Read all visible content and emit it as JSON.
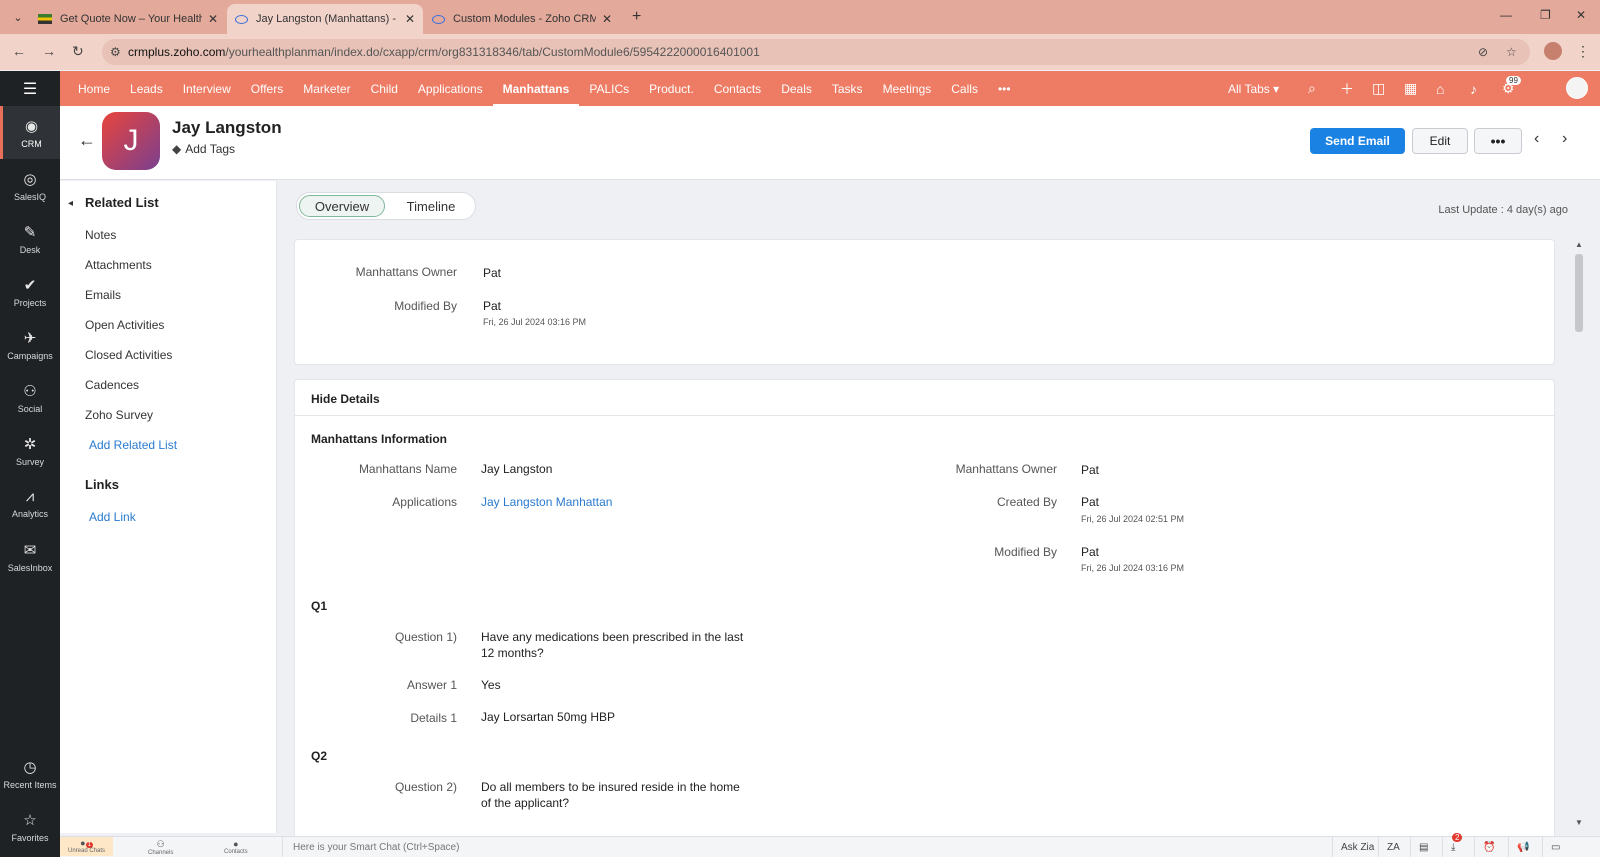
{
  "browser": {
    "tabs": [
      {
        "title": "Get Quote Now – Your Health Pl",
        "favicon": "flag-icon"
      },
      {
        "title": "Jay Langston (Manhattans) - Zoho",
        "favicon": "crm-eye-icon"
      },
      {
        "title": "Custom Modules - Zoho CRM",
        "favicon": "crm-eye-icon"
      }
    ],
    "url_host": "crmplus.zoho.com",
    "url_path": "/yourhealthplanman/index.do/cxapp/crm/org831318346/tab/CustomModule6/5954222000016401001"
  },
  "app_sidebar": {
    "items": [
      {
        "label": "CRM",
        "icon": "◉"
      },
      {
        "label": "SalesIQ",
        "icon": "◎"
      },
      {
        "label": "Desk",
        "icon": "✎"
      },
      {
        "label": "Projects",
        "icon": "✔"
      },
      {
        "label": "Campaigns",
        "icon": "✈"
      },
      {
        "label": "Social",
        "icon": "⚇"
      },
      {
        "label": "Survey",
        "icon": "✲"
      },
      {
        "label": "Analytics",
        "icon": "⩘"
      },
      {
        "label": "SalesInbox",
        "icon": "✉"
      }
    ],
    "bottom": [
      {
        "label": "Recent Items",
        "icon": "◷"
      },
      {
        "label": "Favorites",
        "icon": "☆"
      }
    ]
  },
  "module_nav": {
    "tabs": [
      "Home",
      "Leads",
      "Interview",
      "Offers",
      "Marketer",
      "Child",
      "Applications",
      "Manhattans",
      "PALICs",
      "Product.",
      "Contacts",
      "Deals",
      "Tasks",
      "Meetings",
      "Calls",
      "•••"
    ],
    "active": "Manhattans",
    "all_tabs": "All Tabs ▾",
    "notif_count": "99"
  },
  "record": {
    "initial": "J",
    "name": "Jay Langston",
    "add_tags": "Add Tags",
    "send_email": "Send Email",
    "edit": "Edit",
    "more": "•••"
  },
  "related": {
    "heading": "Related List",
    "items": [
      "Notes",
      "Attachments",
      "Emails",
      "Open Activities",
      "Closed Activities",
      "Cadences",
      "Zoho Survey"
    ],
    "add_related": "Add Related List",
    "links_heading": "Links",
    "add_link": "Add Link"
  },
  "view": {
    "tabs": [
      "Overview",
      "Timeline"
    ],
    "last_update": "Last Update : 4 day(s) ago"
  },
  "summary": {
    "owner_label": "Manhattans Owner",
    "owner_value": "Pat",
    "modified_label": "Modified By",
    "modified_value": "Pat",
    "modified_time": "Fri, 26 Jul 2024 03:16 PM"
  },
  "details": {
    "hide_details": "Hide Details",
    "section_title": "Manhattans Information",
    "name_label": "Manhattans Name",
    "name_value": "Jay Langston",
    "applications_label": "Applications",
    "applications_value": "Jay Langston Manhattan",
    "owner_label": "Manhattans Owner",
    "owner_value": "Pat",
    "created_label": "Created By",
    "created_value": "Pat",
    "created_time": "Fri, 26 Jul 2024 02:51 PM",
    "modified_label": "Modified By",
    "modified_value": "Pat",
    "modified_time": "Fri, 26 Jul 2024 03:16 PM",
    "q1": {
      "heading": "Q1",
      "question_label": "Question 1)",
      "question_line1": "Have any medications been prescribed in the last",
      "question_line2": "12 months?",
      "answer_label": "Answer 1",
      "answer_value": "Yes",
      "details_label": "Details 1",
      "details_value": "Jay Lorsartan 50mg HBP"
    },
    "q2": {
      "heading": "Q2",
      "question_label": "Question 2)",
      "question_line1": "Do all members to be insured reside in the home",
      "question_line2": "of the applicant?"
    }
  },
  "bottom_bar": {
    "items": [
      "Unread Chats",
      "Channels",
      "Contacts"
    ],
    "unread_count": "1",
    "smart_chat": "Here is your Smart Chat (Ctrl+Space)",
    "ask_zia": "Ask Zia",
    "downloads_count": "2"
  }
}
